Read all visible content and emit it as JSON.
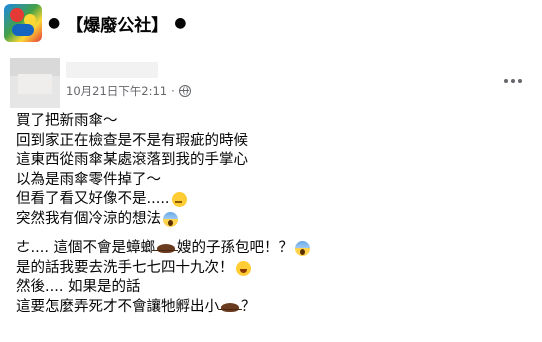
{
  "group": {
    "logo_icon": "group-logo-icon",
    "name": "【爆廢公社】"
  },
  "post": {
    "timestamp": "10月21日下午2:11",
    "separator": "·",
    "privacy_icon": "globe-icon",
    "menu_icon": "more-options-icon",
    "paragraph1": [
      "買了把新雨傘～",
      "回到家正在檢查是不是有瑕疵的時候",
      "這東西從雨傘某處滾落到我的手掌心",
      "以為是雨傘零件掉了～",
      "但看了看又好像不是.....",
      "突然我有個冷涼的想法"
    ],
    "paragraph2": {
      "line1_a": "ㄜ.... 這個不會是蟑螂",
      "line1_b": "嫂的子孫包吧！？",
      "line2": "是的話我要去洗手七七四十九次！",
      "line3": "然後.... 如果是的話",
      "line4_a": "這要怎麼弄死才不會讓牠孵出小",
      "line4_b": "？"
    },
    "emojis": [
      "thinking-face",
      "screaming-face",
      "crying-face",
      "cockroach"
    ]
  }
}
